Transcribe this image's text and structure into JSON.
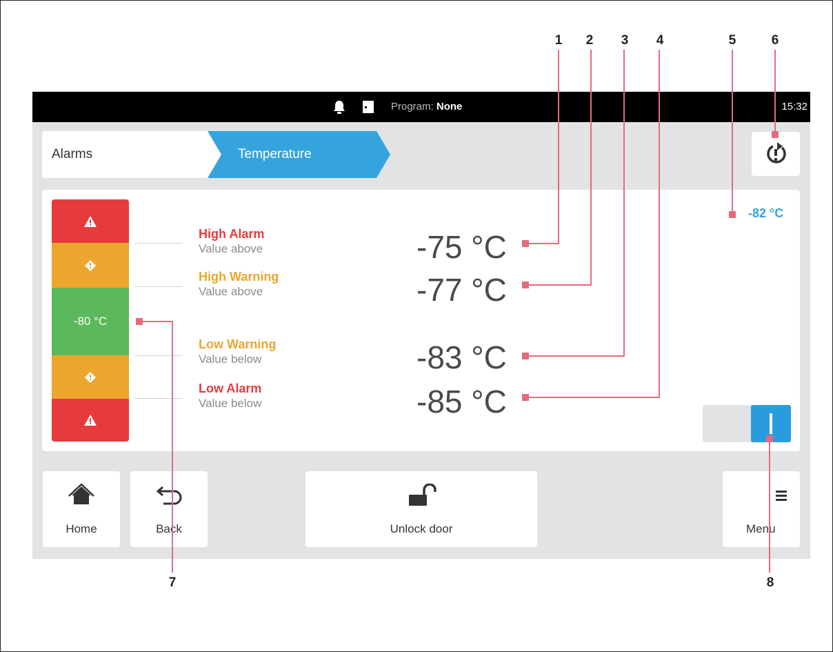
{
  "callouts": [
    "1",
    "2",
    "3",
    "4",
    "5",
    "6",
    "7",
    "8"
  ],
  "status_bar": {
    "program_label": "Program:",
    "program_value": "None",
    "clock": "15:32"
  },
  "breadcrumb": {
    "item1": "Alarms",
    "item2": "Temperature"
  },
  "limit_bar": {
    "current_setpoint": "-80 °C"
  },
  "limits": [
    {
      "title": "High Alarm",
      "subtitle": "Value above",
      "value": "-75 °C",
      "color": "#e63b3b"
    },
    {
      "title": "High Warning",
      "subtitle": "Value above",
      "value": "-77 °C",
      "color": "#eca62d"
    },
    {
      "title": "Low Warning",
      "subtitle": "Value below",
      "value": "-83 °C",
      "color": "#eca62d"
    },
    {
      "title": "Low Alarm",
      "subtitle": "Value below",
      "value": "-85 °C",
      "color": "#e63b3b"
    }
  ],
  "current_temperature": "-82 °C",
  "alarm_toggle": {
    "state": "on"
  },
  "nav": {
    "home": "Home",
    "back": "Back",
    "unlock": "Unlock door",
    "menu": "Menu"
  },
  "colors": {
    "alarm": "#e63b3b",
    "warning": "#eca62d",
    "ok": "#5cb85c",
    "accent": "#35a4dc",
    "callout": "#e66a7c"
  },
  "icons": [
    "bell-icon",
    "door-icon",
    "alarm-reset-icon",
    "warning-triangle-icon",
    "warning-diamond-icon",
    "home-icon",
    "back-icon",
    "unlock-icon",
    "menu-icon"
  ]
}
